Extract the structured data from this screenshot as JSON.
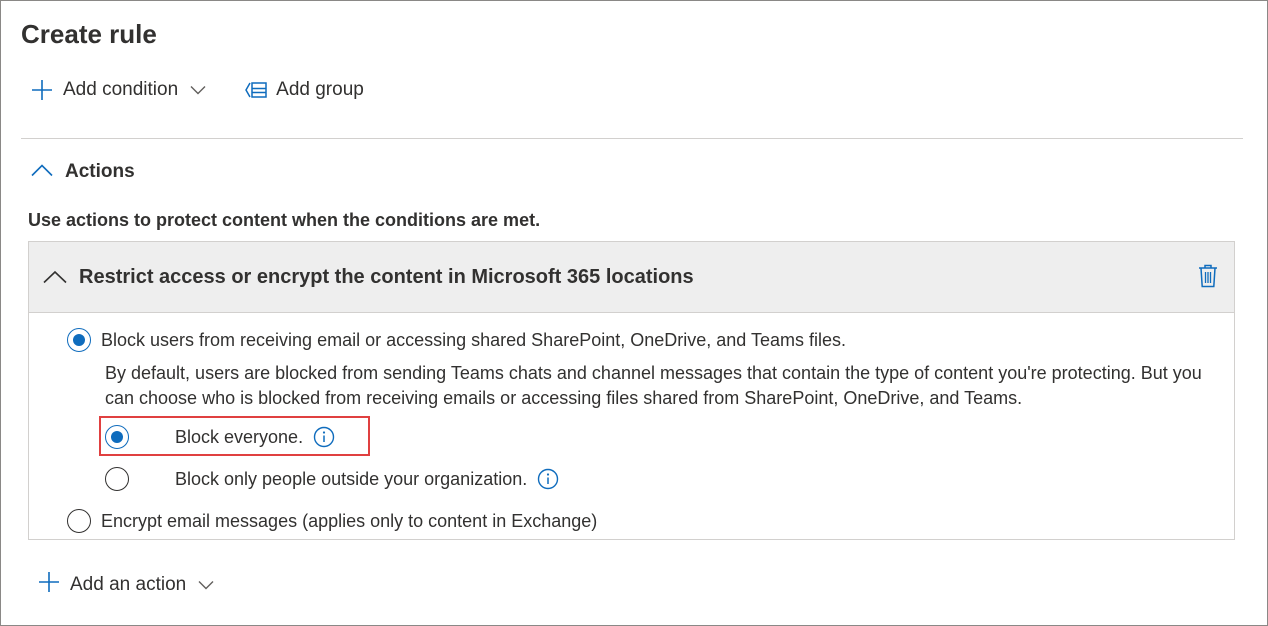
{
  "page": {
    "title": "Create rule"
  },
  "toolbar": {
    "add_condition_label": "Add condition",
    "add_group_label": "Add group"
  },
  "actions_section": {
    "heading": "Actions",
    "description": "Use actions to protect content when the conditions are met.",
    "card": {
      "title": "Restrict access or encrypt the content in Microsoft 365 locations",
      "option_block_users": {
        "label": "Block users from receiving email or accessing shared SharePoint, OneDrive, and Teams files.",
        "selected": true,
        "description": "By default, users are blocked from sending Teams chats and channel messages that contain the type of content you're protecting. But you can choose who is blocked from receiving emails or accessing files shared from SharePoint, OneDrive, and Teams.",
        "suboptions": [
          {
            "label": "Block everyone.",
            "selected": true
          },
          {
            "label": "Block only people outside your organization.",
            "selected": false
          }
        ]
      },
      "option_encrypt": {
        "label": "Encrypt email messages (applies only to content in Exchange)",
        "selected": false
      }
    },
    "add_action_label": "Add an action"
  },
  "colors": {
    "accent": "#0f6cbd",
    "text": "#323130",
    "highlight_box": "#e04040",
    "card_header_bg": "#eeeeee"
  },
  "icons": {
    "add": "plus-icon",
    "dropdown": "chevron-down-icon",
    "group": "add-group-icon",
    "collapse": "chevron-up-icon",
    "delete": "trash-icon",
    "info": "info-icon"
  }
}
